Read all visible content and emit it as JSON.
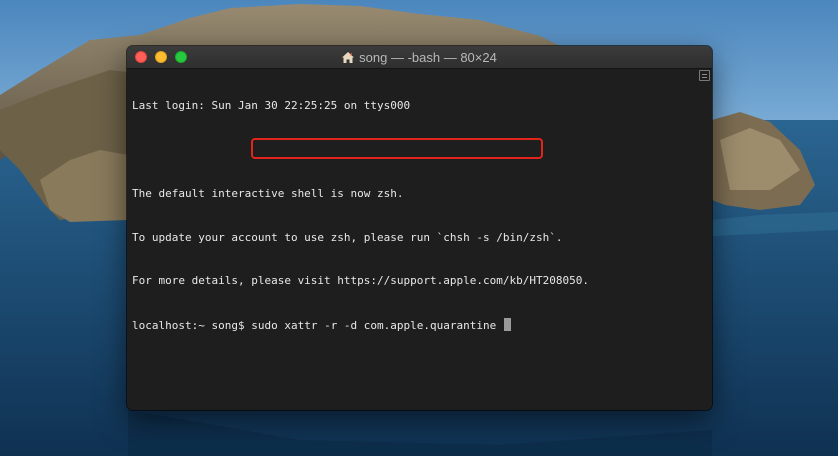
{
  "window": {
    "title": "song — -bash — 80×24",
    "icon": "home-icon"
  },
  "terminal": {
    "lines": [
      "Last login: Sun Jan 30 22:25:25 on ttys000",
      "",
      "The default interactive shell is now zsh.",
      "To update your account to use zsh, please run `chsh -s /bin/zsh`.",
      "For more details, please visit https://support.apple.com/kb/HT208050."
    ],
    "prompt": "localhost:~ song$ ",
    "command": "sudo xattr -r -d com.apple.quarantine"
  },
  "colors": {
    "highlight": "#e1251b",
    "close": "#ff5f57",
    "minimize": "#febc2e",
    "zoom": "#28c840"
  }
}
